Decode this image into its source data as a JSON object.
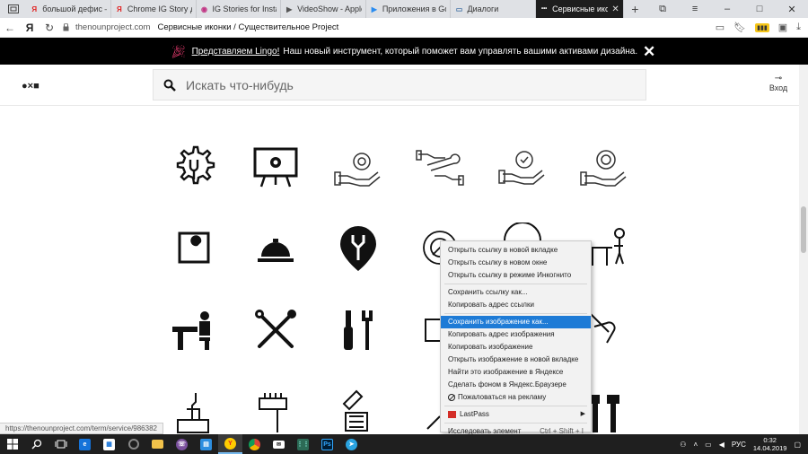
{
  "browser": {
    "tabs": [
      {
        "title": "большой дефис — Я",
        "fav": "Я",
        "fav_color": "#e02020"
      },
      {
        "title": "Chrome IG Story для",
        "fav": "Я",
        "fav_color": "#e02020"
      },
      {
        "title": "IG Stories for Instagra",
        "fav": "◉",
        "fav_color": "#c13584"
      },
      {
        "title": "VideoShow - Apple (R",
        "fav": "▶",
        "fav_color": "#555555"
      },
      {
        "title": "Приложения в Goog",
        "fav": "▶",
        "fav_color": "#2a8cf0"
      },
      {
        "title": "Диалоги",
        "fav": "▭",
        "fav_color": "#4a76a8"
      },
      {
        "title": "Сервисные иконк",
        "fav": "•••",
        "fav_color": "#1e1e1e"
      }
    ],
    "url": "thenounproject.com",
    "page_title": "Сервисные иконки / Существительное Project"
  },
  "banner": {
    "link_text": "Представляем Lingo!",
    "message": "Наш новый инструмент, который поможет вам управлять вашими активами дизайна."
  },
  "header": {
    "logo": "●×■",
    "search_placeholder": "Искать что-нибудь",
    "login_label": "Вход"
  },
  "context_menu": {
    "items": [
      "Открыть ссылку в новой вкладке",
      "Открыть ссылку в новом окне",
      "Открыть ссылку в режиме Инкогнито",
      "Сохранить ссылку как...",
      "Копировать адрес ссылки",
      "Сохранить изображение как...",
      "Копировать адрес изображения",
      "Копировать изображение",
      "Открыть изображение в новой вкладке",
      "Найти это изображение в Яндексе",
      "Сделать фоном в Яндекс.Браузере",
      "Пожаловаться на рекламу",
      "LastPass",
      "Исследовать элемент"
    ],
    "inspect_shortcut": "Ctrl + Shift + I",
    "highlighted_item": "Сохранить изображение как..."
  },
  "status_url": "https://thenounproject.com/term/service/986382",
  "taskbar": {
    "language": "РУС",
    "time": "0:32",
    "date": "14.04.2019"
  },
  "icons": [
    "gear-wrench-icon",
    "monitor-gear-icon",
    "hand-gear-outline-icon",
    "hands-wrench-outline-icon",
    "hand-gear-outline-icon-2",
    "hand-gear-outline-icon-3",
    "wrench-square-icon",
    "service-bell-icon",
    "wrench-map-pin-icon",
    "gear-wrench-outline-icon",
    "support-agent-icon",
    "desk-worker-icon",
    "desk-worker-icon-2",
    "crossed-tools-icon",
    "wrench-screwdriver-icon",
    "tool-box-icon",
    "hand-tool-icon",
    "hand-wrench-icon",
    "hand-wrench-icon-2",
    "hand-wrench-icon-3",
    "hand-wrench-icon-4",
    "wrench-pliers-icon"
  ]
}
